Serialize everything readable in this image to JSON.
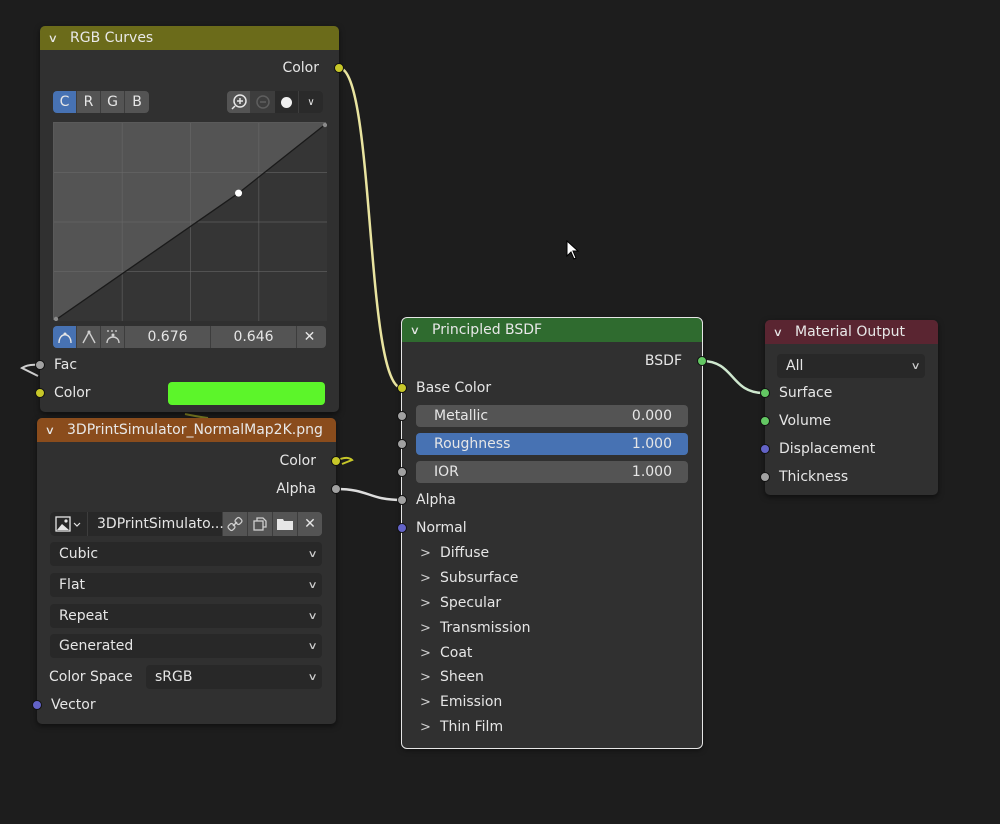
{
  "rgb_curves": {
    "title": "RGB Curves",
    "header_color": "#6b6b1a",
    "output_color_label": "Color",
    "channels": [
      "C",
      "R",
      "G",
      "B"
    ],
    "active_channel": "C",
    "zoom_in_icon": "zoom-in-icon",
    "zoom_out_icon": "zoom-out-icon",
    "clip_icon": "clipping-icon",
    "menu_icon": "chevron-down-icon",
    "handle_types": [
      "auto-handle-icon",
      "vector-handle-icon",
      "auto-clamped-handle-icon"
    ],
    "point_x": "0.676",
    "point_y": "0.646",
    "delete_icon": "close-icon",
    "curve_points": [
      [
        0,
        0
      ],
      [
        0.676,
        0.646
      ],
      [
        1,
        1
      ]
    ],
    "fac_label": "Fac",
    "color_input_label": "Color",
    "color_swatch": "#5cf52a"
  },
  "image_texture": {
    "title": "3DPrintSimulator_NormalMap2K.png",
    "header_color": "#8a4c1c",
    "output_color_label": "Color",
    "output_alpha_label": "Alpha",
    "image_name": "3DPrintSimulato...",
    "interpolation": "Cubic",
    "projection": "Flat",
    "extension": "Repeat",
    "source": "Generated",
    "color_space_label": "Color Space",
    "color_space": "sRGB",
    "vector_label": "Vector"
  },
  "principled_bsdf": {
    "title": "Principled BSDF",
    "header_color": "#2f6b2f",
    "output_label": "BSDF",
    "base_color_label": "Base Color",
    "fields": [
      {
        "label": "Metallic",
        "value": "0.000"
      },
      {
        "label": "Roughness",
        "value": "1.000"
      },
      {
        "label": "IOR",
        "value": "1.000"
      }
    ],
    "alpha_label": "Alpha",
    "normal_label": "Normal",
    "panels": [
      "Diffuse",
      "Subsurface",
      "Specular",
      "Transmission",
      "Coat",
      "Sheen",
      "Emission",
      "Thin Film"
    ]
  },
  "material_output": {
    "title": "Material Output",
    "header_color": "#5a2531",
    "target": "All",
    "inputs": [
      "Surface",
      "Volume",
      "Displacement",
      "Thickness"
    ]
  }
}
